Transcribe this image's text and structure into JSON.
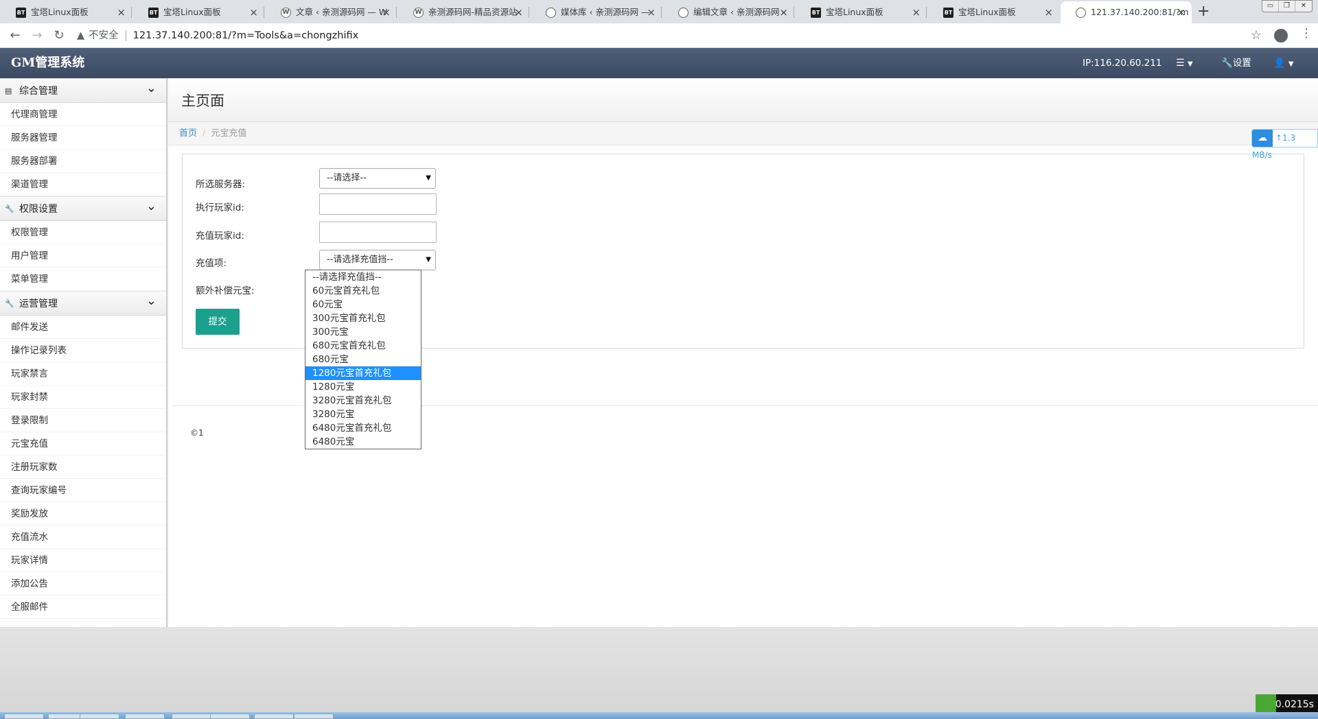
{
  "browser": {
    "tabs": [
      {
        "favicon": "bt",
        "favicon_text": "BT",
        "title": "宝塔Linux面板"
      },
      {
        "favicon": "bt",
        "favicon_text": "BT",
        "title": "宝塔Linux面板"
      },
      {
        "favicon": "wp",
        "favicon_text": "W",
        "title": "文章 ‹ 亲测源码网 — W"
      },
      {
        "favicon": "wp",
        "favicon_text": "W",
        "title": "亲测源码网-精品资源站"
      },
      {
        "favicon": "globe",
        "favicon_text": "",
        "title": "媒体库 ‹ 亲测源码网 —"
      },
      {
        "favicon": "globe",
        "favicon_text": "",
        "title": "编辑文章 ‹ 亲测源码网 -"
      },
      {
        "favicon": "bt",
        "favicon_text": "BT",
        "title": "宝塔Linux面板"
      },
      {
        "favicon": "bt",
        "favicon_text": "BT",
        "title": "宝塔Linux面板"
      },
      {
        "favicon": "globe",
        "favicon_text": "",
        "title": "121.37.140.200:81/?m"
      }
    ],
    "active_tab_index": 8,
    "security_label": "不安全",
    "url": "121.37.140.200:81/?m=Tools&a=chongzhifix"
  },
  "header": {
    "brand": "GM管理系统",
    "ip": "IP:116.20.60.211",
    "settings_label": "设置"
  },
  "sidebar": {
    "groups": [
      {
        "label": "综合管理",
        "icon": "server-icon",
        "items": [
          "代理商管理",
          "服务器管理",
          "服务器部署",
          "渠道管理"
        ]
      },
      {
        "label": "权限设置",
        "icon": "wrench-icon",
        "items": [
          "权限管理",
          "用户管理",
          "菜单管理"
        ]
      },
      {
        "label": "运营管理",
        "icon": "wrench-icon",
        "items": [
          "邮件发送",
          "操作记录列表",
          "玩家禁言",
          "玩家封禁",
          "登录限制",
          "元宝充值",
          "注册玩家数",
          "查询玩家编号",
          "奖励发放",
          "充值流水",
          "玩家详情",
          "添加公告",
          "全服邮件"
        ]
      }
    ]
  },
  "page": {
    "title": "主页面",
    "breadcrumb": {
      "home": "首页",
      "current": "元宝充值"
    },
    "speed": "1.3 MB/s"
  },
  "form": {
    "server_label": "所选服务器:",
    "server_value": "--请选择--",
    "exec_player_label": "执行玩家id:",
    "exec_player_value": "",
    "recharge_player_label": "充值玩家id:",
    "recharge_player_value": "",
    "item_label": "充值项:",
    "item_value": "--请选择充值挡--",
    "extra_label": "额外补偿元宝:",
    "submit_label": "提交"
  },
  "dropdown": {
    "options": [
      "--请选择充值挡--",
      "60元宝首充礼包",
      "60元宝",
      "300元宝首充礼包",
      "300元宝",
      "680元宝首充礼包",
      "680元宝",
      "1280元宝首充礼包",
      "1280元宝",
      "3280元宝首充礼包",
      "3280元宝",
      "6480元宝首充礼包",
      "6480元宝"
    ],
    "highlighted_index": 7
  },
  "footer": {
    "text": "©1"
  },
  "overlay": {
    "timer": "0.0215s"
  }
}
